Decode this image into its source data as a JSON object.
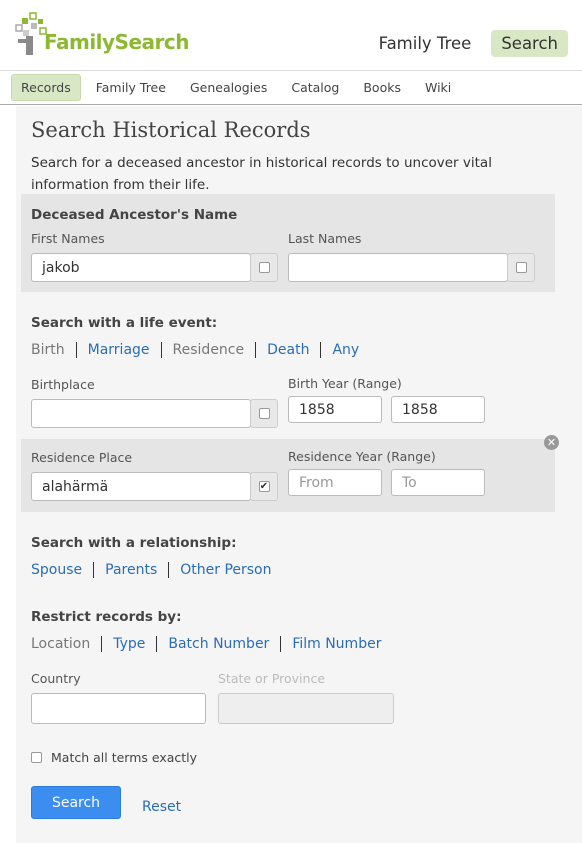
{
  "brand": {
    "name": "FamilySearch"
  },
  "top_nav": [
    {
      "label": "Family Tree"
    },
    {
      "label": "Search"
    }
  ],
  "subnav": [
    "Records",
    "Family Tree",
    "Genealogies",
    "Catalog",
    "Books",
    "Wiki"
  ],
  "page": {
    "title": "Search Historical Records",
    "description": "Search for a deceased ancestor in historical records to uncover vital information from their life."
  },
  "name_section": {
    "heading": "Deceased Ancestor's Name",
    "first_names_label": "First Names",
    "first_names_value": "jakob",
    "last_names_label": "Last Names",
    "last_names_value": ""
  },
  "life_event": {
    "heading": "Search with a life event:",
    "links": [
      "Birth",
      "Marriage",
      "Residence",
      "Death",
      "Any"
    ],
    "birthplace_label": "Birthplace",
    "birthplace_value": "",
    "birth_year_label": "Birth Year (Range)",
    "birth_year_from": "1858",
    "birth_year_to": "1858",
    "residence_place_label": "Residence Place",
    "residence_place_value": "alahärmä",
    "residence_year_label": "Residence Year (Range)",
    "residence_year_from_placeholder": "From",
    "residence_year_to_placeholder": "To"
  },
  "relationship": {
    "heading": "Search with a relationship:",
    "links": [
      "Spouse",
      "Parents",
      "Other Person"
    ]
  },
  "restrict": {
    "heading": "Restrict records by:",
    "links": [
      "Location",
      "Type",
      "Batch Number",
      "Film Number"
    ],
    "country_label": "Country",
    "country_value": "",
    "state_label": "State or Province",
    "state_value": ""
  },
  "match_exact_label": "Match all terms exactly",
  "buttons": {
    "search": "Search",
    "reset": "Reset"
  },
  "colors": {
    "brand_green": "#8cb832",
    "link_blue": "#2a6db5",
    "button_blue": "#3b8def",
    "active_tab": "#d9e8c4"
  }
}
